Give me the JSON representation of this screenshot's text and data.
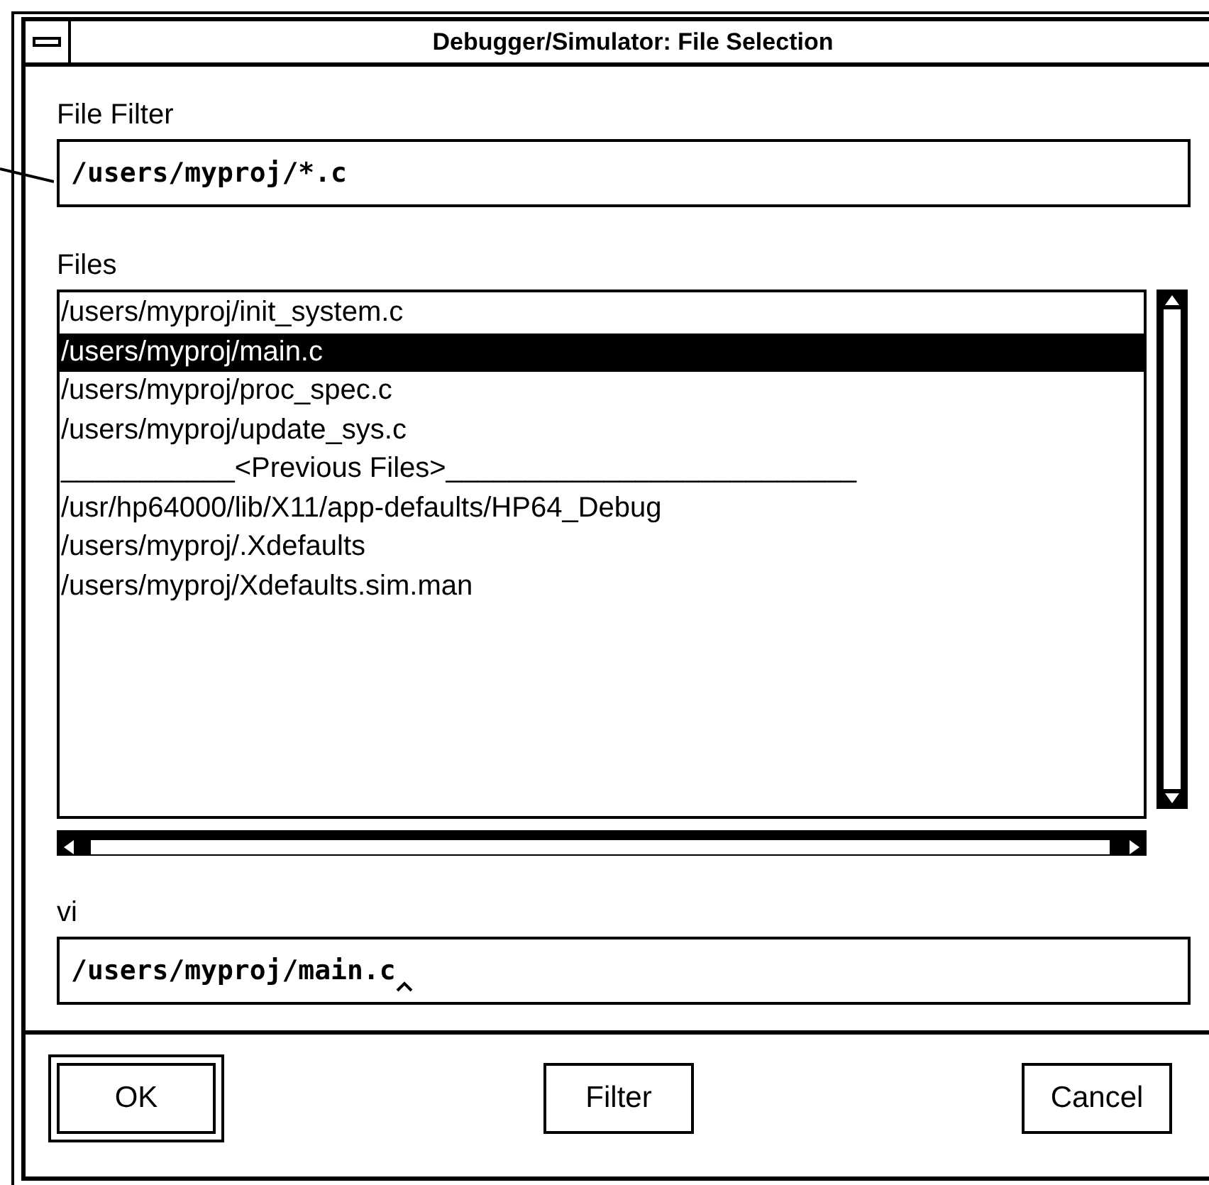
{
  "window": {
    "title": "Debugger/Simulator: File Selection"
  },
  "filter": {
    "label": "File Filter",
    "value": "/users/myproj/*.c"
  },
  "files": {
    "label": "Files",
    "items": [
      {
        "text": "/users/myproj/init_system.c",
        "selected": false
      },
      {
        "text": "/users/myproj/main.c",
        "selected": true
      },
      {
        "text": "/users/myproj/proc_spec.c",
        "selected": false
      },
      {
        "text": "/users/myproj/update_sys.c",
        "selected": false
      },
      {
        "text": "___________<Previous Files>__________________________",
        "selected": false
      },
      {
        "text": "/usr/hp64000/lib/X11/app-defaults/HP64_Debug",
        "selected": false
      },
      {
        "text": "/users/myproj/.Xdefaults",
        "selected": false
      },
      {
        "text": "/users/myproj/Xdefaults.sim.man",
        "selected": false
      }
    ]
  },
  "selection": {
    "label": "vi",
    "value": "/users/myproj/main.c"
  },
  "buttons": [
    {
      "label": "OK",
      "default": true
    },
    {
      "label": "Filter",
      "default": false
    },
    {
      "label": "Cancel",
      "default": false
    }
  ]
}
